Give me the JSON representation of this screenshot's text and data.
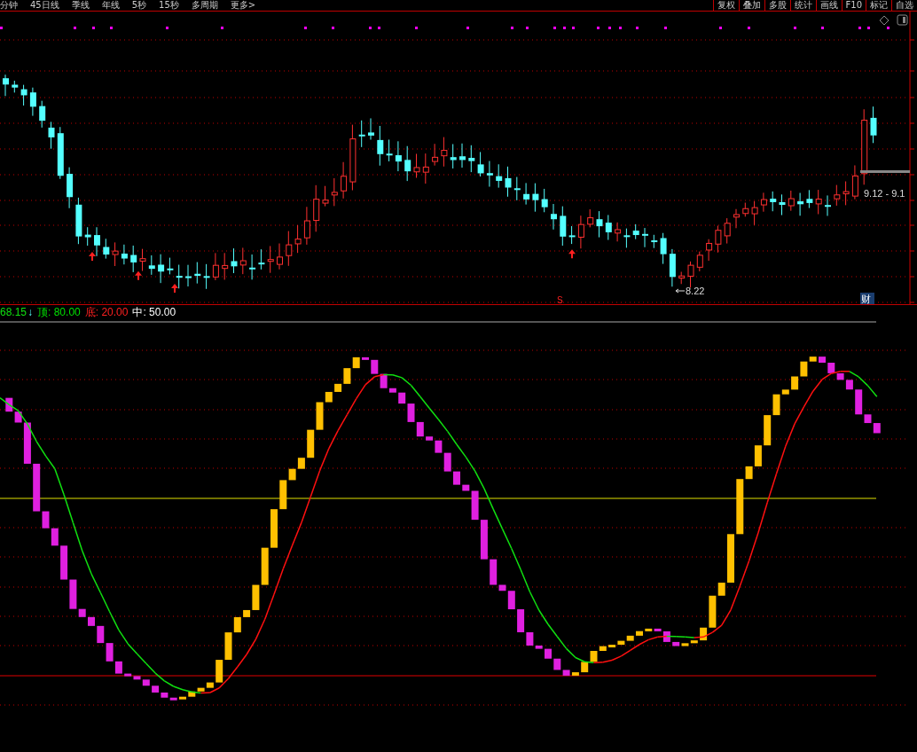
{
  "toolbar": {
    "periods": [
      {
        "label": "分钟"
      },
      {
        "label": "45日线"
      },
      {
        "label": "季线"
      },
      {
        "label": "年线"
      },
      {
        "label": "5秒"
      },
      {
        "label": "15秒"
      },
      {
        "label": "多周期"
      },
      {
        "label": "更多>"
      }
    ],
    "tools": [
      {
        "label": "复权"
      },
      {
        "label": "叠加"
      },
      {
        "label": "多股"
      },
      {
        "label": "统计"
      },
      {
        "label": "画线"
      },
      {
        "label": "F10"
      },
      {
        "label": "标记"
      },
      {
        "label": "自选"
      }
    ]
  },
  "price_chart": {
    "low_label": "8.22",
    "range_label": "9.12 - 9.1",
    "signal_mark": "S",
    "finance_badge": "财"
  },
  "indicator": {
    "value": "68.15",
    "trend_arrow": "↓",
    "legend": [
      {
        "label": "顶: 80.00",
        "color": "#00e000"
      },
      {
        "label": "底: 20.00",
        "color": "#ff2020"
      },
      {
        "label": "中: 50.00",
        "color": "#ffffff"
      }
    ]
  }
}
